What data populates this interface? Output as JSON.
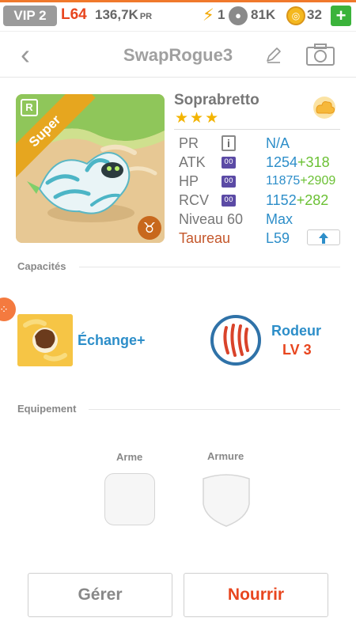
{
  "status_bar": {
    "vip": "VIP 2",
    "level": "L64",
    "pr_value": "136,7K",
    "pr_unit": "PR",
    "energy": "1",
    "paws": "81K",
    "coins": "32",
    "plus": "+"
  },
  "header": {
    "back": "‹",
    "title": "SwapRogue3"
  },
  "monster": {
    "rarity_badge": "R",
    "rank_ribbon": "Super",
    "zodiac_symbol": "♉",
    "name": "Soprabretto",
    "stars": "★★★",
    "star_count": 3,
    "stats": {
      "pr_label": "PR",
      "pr_info": "i",
      "pr_value": "N/A",
      "atk_label": "ATK",
      "atk_badge": "00",
      "atk_value": "1254",
      "atk_bonus": "+318",
      "hp_label": "HP",
      "hp_badge": "00",
      "hp_value": "11875",
      "hp_bonus": "+2909",
      "rcv_label": "RCV",
      "rcv_badge": "00",
      "rcv_value": "1152",
      "rcv_bonus": "+282",
      "level_label": "Niveau 60",
      "level_value": "Max",
      "sign_label": "Taureau",
      "sign_value": "L59"
    }
  },
  "abilities": {
    "section_title": "Capacités",
    "active_name": "Échange+",
    "leader_name": "Rodeur",
    "leader_level": "LV 3"
  },
  "equipment": {
    "section_title": "Equipement",
    "weapon_label": "Arme",
    "armor_label": "Armure"
  },
  "actions": {
    "manage": "Gérer",
    "feed": "Nourrir"
  },
  "colors": {
    "accent_orange": "#e8461f",
    "stat_blue": "#2d8ec9",
    "bonus_green": "#6ac033",
    "star_gold": "#f3b400"
  }
}
